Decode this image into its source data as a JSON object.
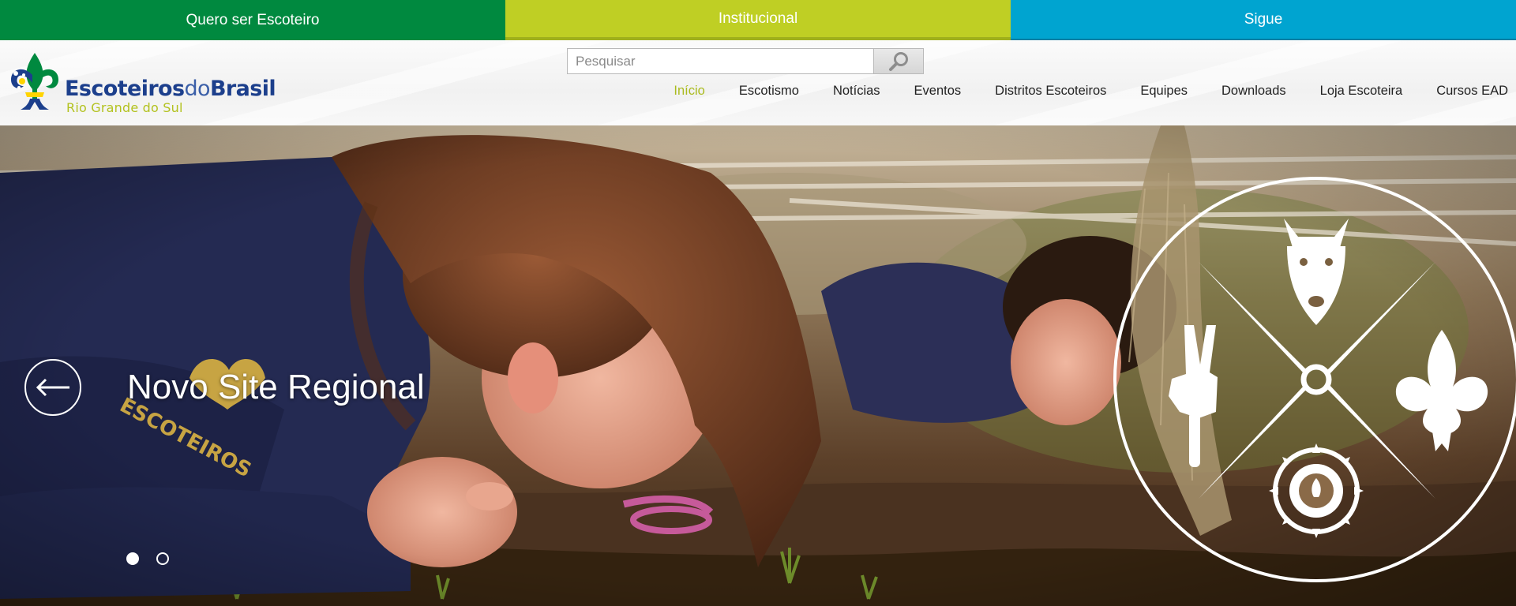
{
  "topbar": {
    "items": [
      {
        "label": "Quero ser Escoteiro",
        "color": "#00893f"
      },
      {
        "label": "Institucional",
        "color": "#bfcf24"
      },
      {
        "label": "Sigue",
        "color": "#00a4d0"
      }
    ]
  },
  "logo": {
    "brand_bold": "Escoteiros",
    "brand_light": "do",
    "brand_bold2": "Brasil",
    "subtitle": "Rio Grande do Sul"
  },
  "search": {
    "placeholder": "Pesquisar",
    "icon": "search-icon"
  },
  "nav": {
    "items": [
      {
        "label": "Início",
        "active": true
      },
      {
        "label": "Escotismo"
      },
      {
        "label": "Notícias"
      },
      {
        "label": "Eventos"
      },
      {
        "label": "Distritos Escoteiros"
      },
      {
        "label": "Equipes"
      },
      {
        "label": "Downloads"
      },
      {
        "label": "Loja Escoteira"
      },
      {
        "label": "Cursos EAD"
      }
    ],
    "active_color": "#aabb1e"
  },
  "hero": {
    "caption": "Novo Site Regional",
    "slides_count": 2,
    "current_slide": 1,
    "prev_icon": "arrow-left-icon"
  }
}
